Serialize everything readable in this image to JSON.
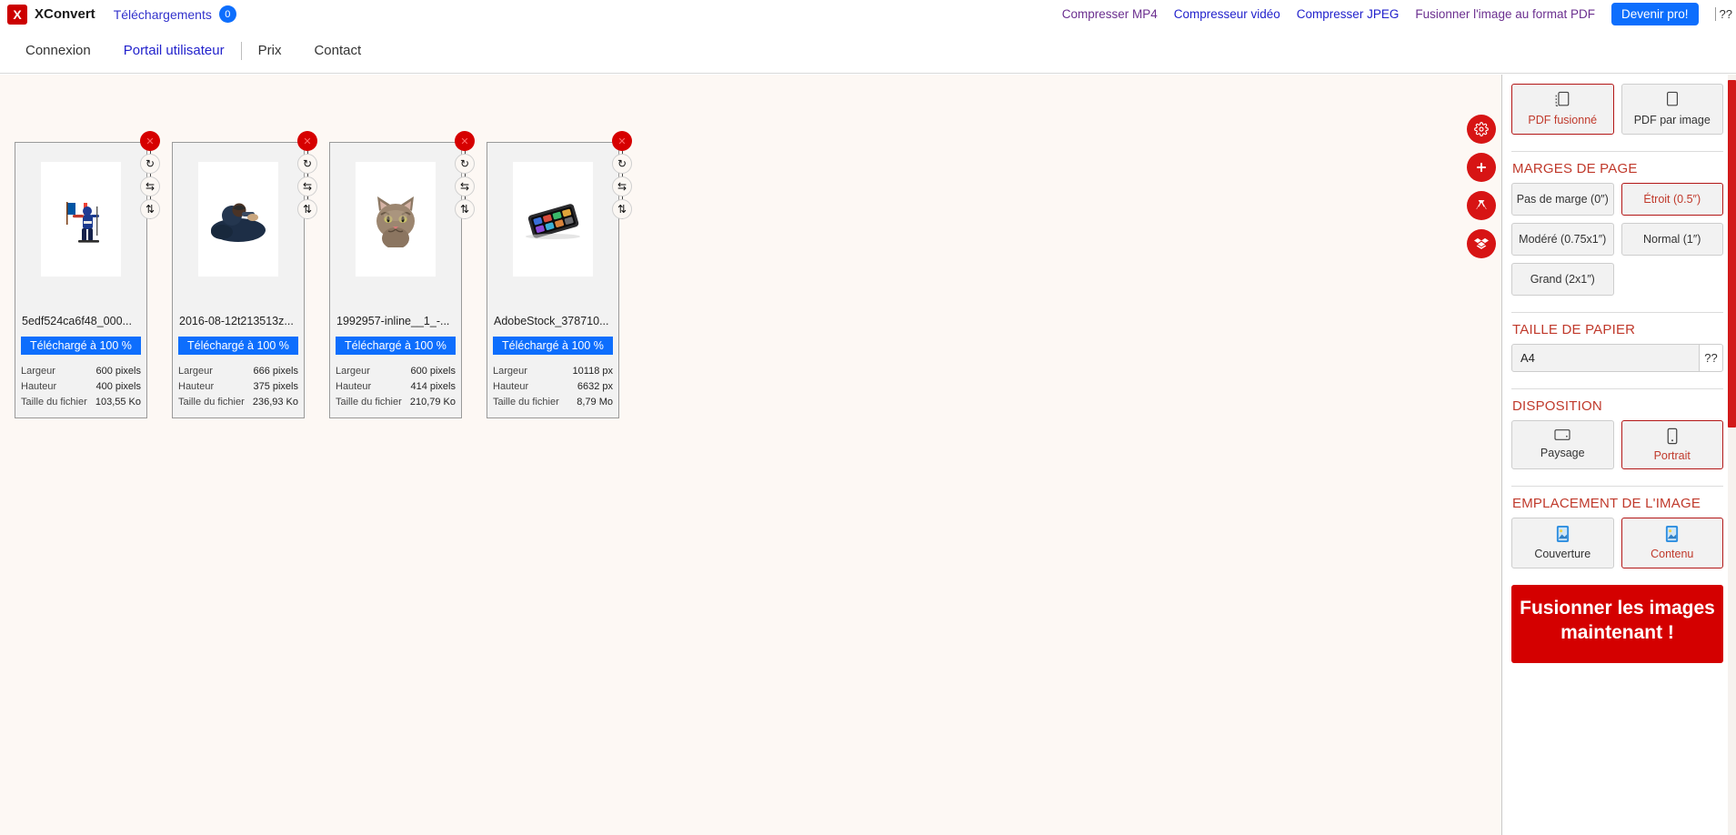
{
  "topbar": {
    "logo_letter": "X",
    "brand": "XConvert",
    "downloads_label": "Téléchargements",
    "downloads_count": "0",
    "links": [
      {
        "label": "Compresser MP4",
        "style": "visited"
      },
      {
        "label": "Compresseur vidéo",
        "style": "blue"
      },
      {
        "label": "Compresser JPEG",
        "style": "blue"
      },
      {
        "label": "Fusionner l'image au format PDF",
        "style": "visited"
      }
    ],
    "pro_button": "Devenir pro!",
    "lang": "??"
  },
  "subnav": {
    "items": [
      {
        "label": "Connexion",
        "active": false
      },
      {
        "label": "Portail utilisateur",
        "active": true
      },
      {
        "label": "Prix",
        "active": false
      },
      {
        "label": "Contact",
        "active": false
      }
    ]
  },
  "cards": [
    {
      "filename": "5edf524ca6f48_000...",
      "progress": "Téléchargé à 100 %",
      "stats": [
        {
          "label": "Largeur",
          "value": "600 pixels"
        },
        {
          "label": "Hauteur",
          "value": "400 pixels"
        },
        {
          "label": "Taille du fichier",
          "value": "103,55 Ko"
        }
      ],
      "thumb": "skier-flag"
    },
    {
      "filename": "2016-08-12t213513z...",
      "progress": "Téléchargé à 100 %",
      "stats": [
        {
          "label": "Largeur",
          "value": "666 pixels"
        },
        {
          "label": "Hauteur",
          "value": "375 pixels"
        },
        {
          "label": "Taille du fichier",
          "value": "236,93 Ko"
        }
      ],
      "thumb": "person-dark"
    },
    {
      "filename": "1992957-inline__1_-...",
      "progress": "Téléchargé à 100 %",
      "stats": [
        {
          "label": "Largeur",
          "value": "600 pixels"
        },
        {
          "label": "Hauteur",
          "value": "414 pixels"
        },
        {
          "label": "Taille du fichier",
          "value": "210,79 Ko"
        }
      ],
      "thumb": "cat"
    },
    {
      "filename": "AdobeStock_378710...",
      "progress": "Téléchargé à 100 %",
      "stats": [
        {
          "label": "Largeur",
          "value": "10118 px"
        },
        {
          "label": "Hauteur",
          "value": "6632 px"
        },
        {
          "label": "Taille du fichier",
          "value": "8,79 Mo"
        }
      ],
      "thumb": "phone"
    }
  ],
  "card_tools": {
    "delete": "close-icon",
    "rotate": "rotate-icon",
    "flip_h": "flip-horizontal-icon",
    "flip_v": "flip-vertical-icon"
  },
  "fabs": [
    {
      "name": "settings-icon"
    },
    {
      "name": "plus-icon"
    },
    {
      "name": "google-drive-icon"
    },
    {
      "name": "dropbox-icon"
    }
  ],
  "panel": {
    "output_modes": [
      {
        "label": "PDF fusionné",
        "selected": true,
        "icon": "multi-page-icon"
      },
      {
        "label": "PDF par image",
        "selected": false,
        "icon": "single-page-icon"
      }
    ],
    "margins": {
      "title": "MARGES DE PAGE",
      "options": [
        {
          "label": "Pas de marge (0″)",
          "selected": false
        },
        {
          "label": "Étroit (0.5″)",
          "selected": true
        },
        {
          "label": "Modéré (0.75x1″)",
          "selected": false
        },
        {
          "label": "Normal (1″)",
          "selected": false
        },
        {
          "label": "Grand (2x1″)",
          "selected": false
        }
      ]
    },
    "paper": {
      "title": "TAILLE DE PAPIER",
      "value": "A4",
      "caret": "??"
    },
    "layout": {
      "title": "DISPOSITION",
      "options": [
        {
          "label": "Paysage",
          "selected": false,
          "icon": "landscape-icon"
        },
        {
          "label": "Portrait",
          "selected": true,
          "icon": "portrait-icon"
        }
      ]
    },
    "placement": {
      "title": "EMPLACEMENT DE L'IMAGE",
      "options": [
        {
          "label": "Couverture",
          "selected": false,
          "icon": "image-icon"
        },
        {
          "label": "Contenu",
          "selected": true,
          "icon": "image-icon"
        }
      ]
    },
    "cta": "Fusionner les images maintenant !"
  },
  "colors": {
    "brand_red": "#cc0000",
    "accent_red": "#c0392b",
    "link_blue": "#2222cc",
    "visited_purple": "#6b2f8f",
    "progress_blue": "#0d6efd",
    "canvas_bg": "#fdf8f4"
  }
}
